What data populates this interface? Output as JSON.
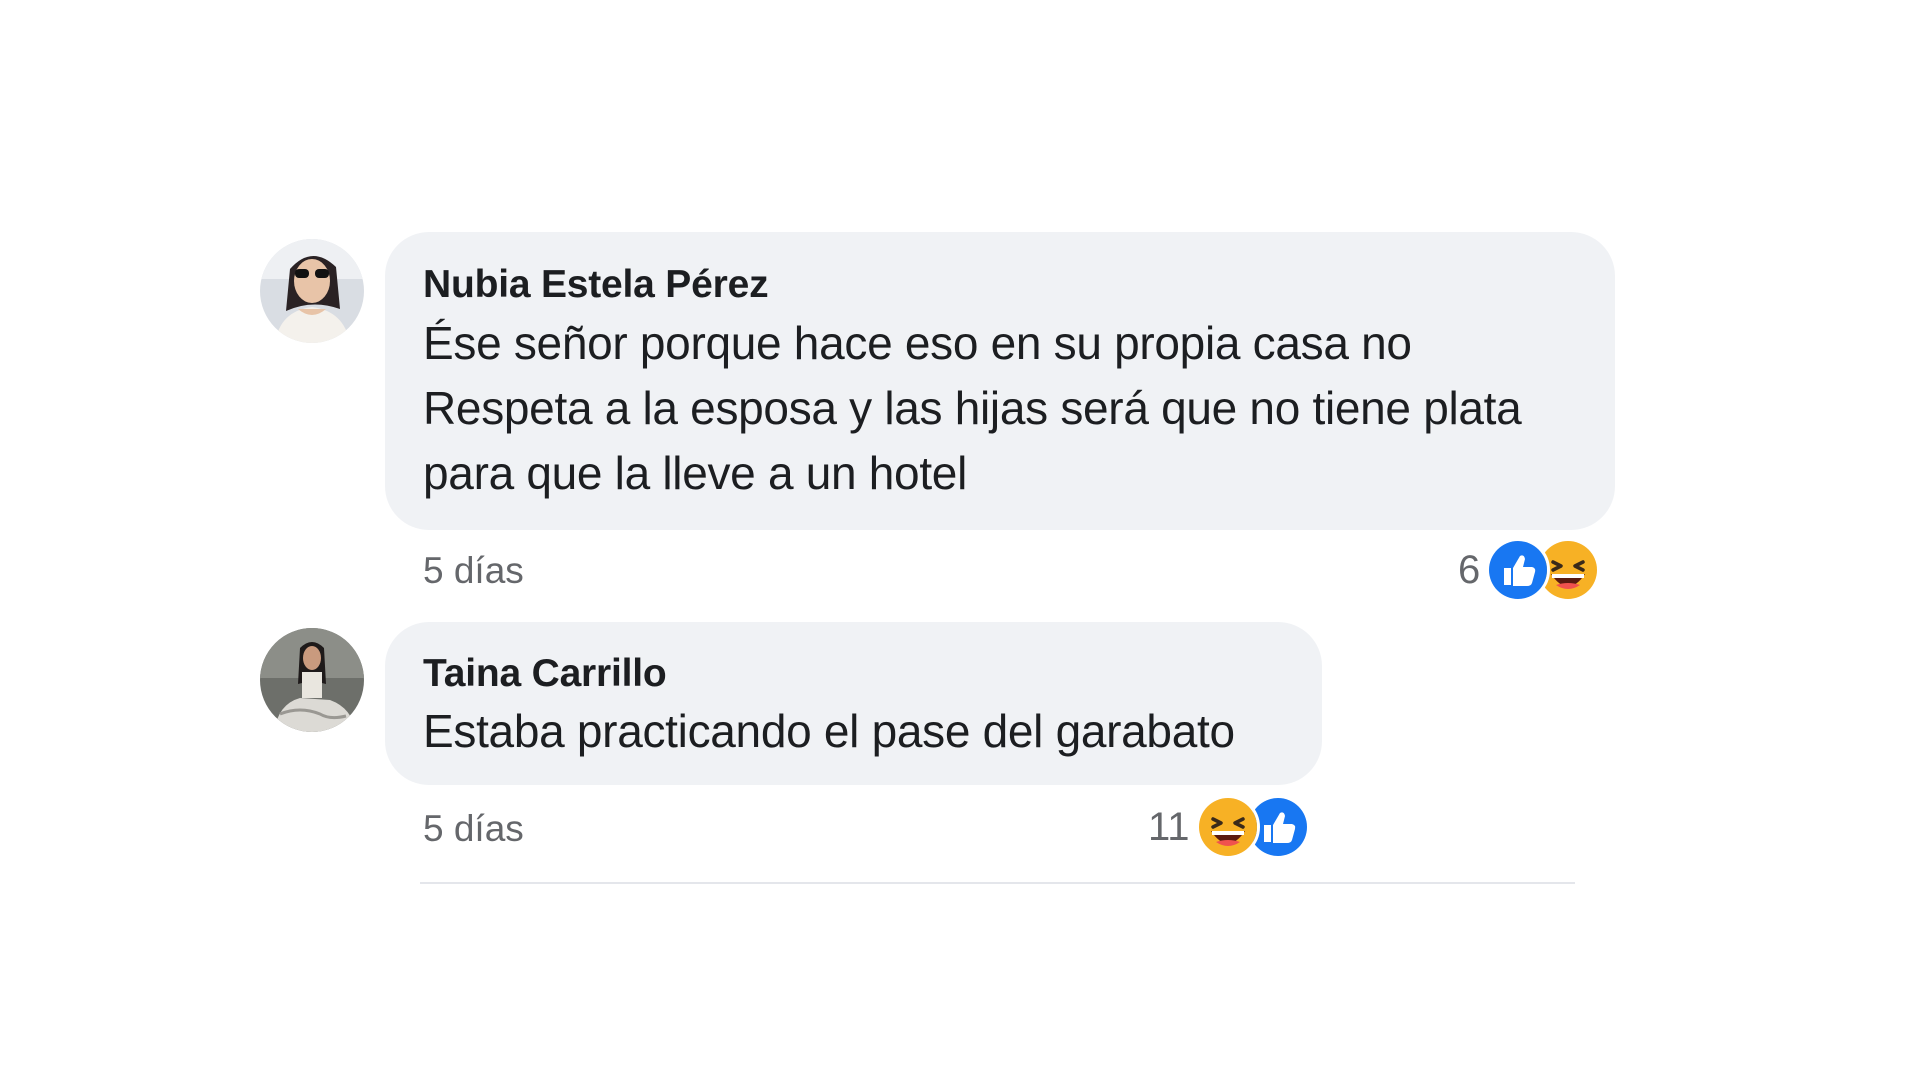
{
  "comments": [
    {
      "author": "Nubia Estela Pérez",
      "text_lines": [
        "Ése señor porque hace eso en su propia casa no",
        "Respeta a la esposa y las hijas será que no tiene plata",
        "para que la lleve a un hotel"
      ],
      "time": "5 días",
      "reaction_count": "6",
      "reactions": [
        "like-icon",
        "haha-icon"
      ]
    },
    {
      "author": "Taina Carrillo",
      "text_lines": [
        "Estaba practicando el pase del garabato"
      ],
      "time": "5 días",
      "reaction_count": "11",
      "reactions": [
        "haha-icon",
        "like-icon"
      ]
    }
  ],
  "colors": {
    "bubble": "#f0f2f5",
    "like_blue": "#1877f2",
    "haha_yellow": "#f7b125",
    "meta_gray": "#65676b"
  }
}
